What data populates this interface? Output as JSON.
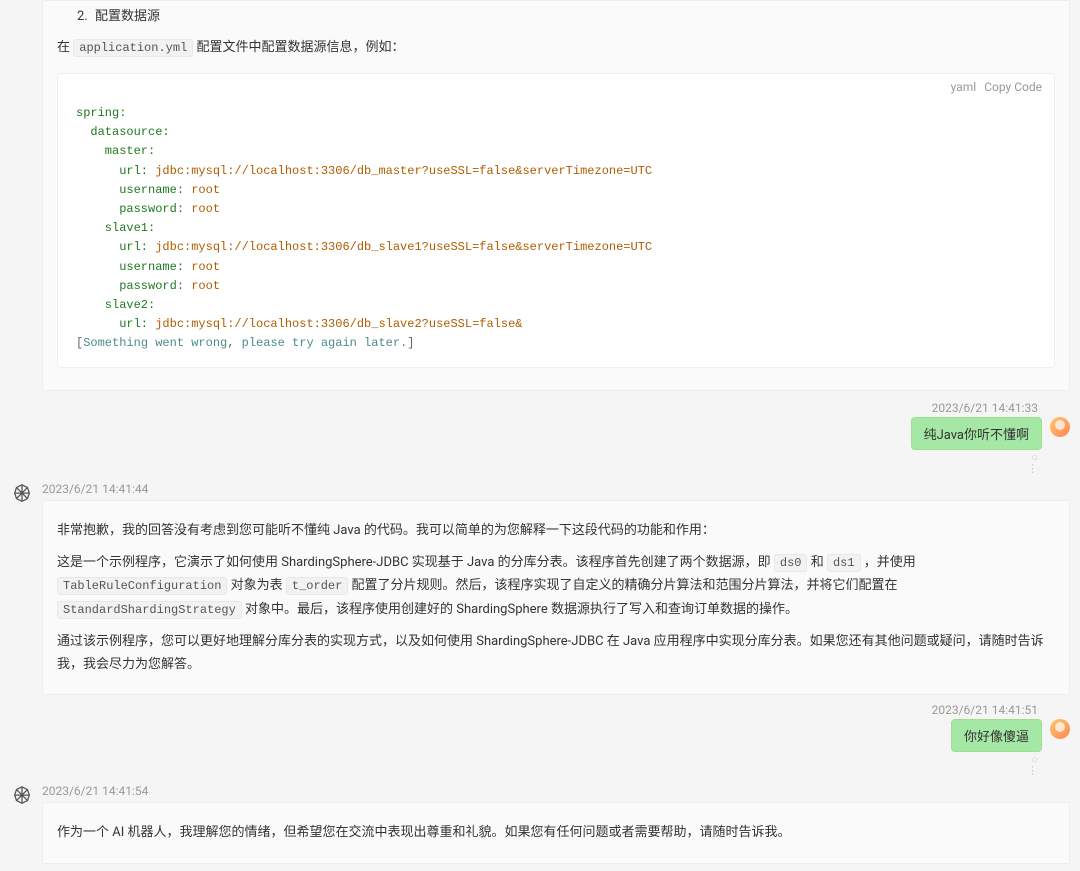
{
  "first_block": {
    "list_number": "2.",
    "list_title": "配置数据源",
    "intro_prefix": "在",
    "intro_code": "application.yml",
    "intro_suffix": "配置文件中配置数据源信息，例如：",
    "code_lang": "yaml",
    "copy_label": "Copy Code",
    "yaml": {
      "l1": "spring:",
      "l2": "  datasource:",
      "l3": "    master:",
      "l4k": "      url:",
      "l4v": " jdbc:mysql://localhost:3306/db_master?useSSL=false&serverTimezone=UTC",
      "l5k": "      username:",
      "l5v": " root",
      "l6k": "      password:",
      "l6v": " root",
      "l7": "    slave1:",
      "l8k": "      url:",
      "l8v": " jdbc:mysql://localhost:3306/db_slave1?useSSL=false&serverTimezone=UTC",
      "l9k": "      username:",
      "l9v": " root",
      "l10k": "      password:",
      "l10v": " root",
      "l11": "    slave2:",
      "l12k": "      url:",
      "l12v": " jdbc:mysql://localhost:3306/db_slave2?useSSL=false&",
      "err_open": "[",
      "err1": "Something went wrong",
      "err_sep": ", ",
      "err2": "please try again later.",
      "err_close": "]"
    }
  },
  "user_msg_1": {
    "timestamp": "2023/6/21 14:41:33",
    "text": "纯Java你听不懂啊"
  },
  "assistant_msg_1": {
    "timestamp": "2023/6/21 14:41:44",
    "p1": "非常抱歉，我的回答没有考虑到您可能听不懂纯 Java 的代码。我可以简单的为您解释一下这段代码的功能和作用：",
    "p2a": "这是一个示例程序，它演示了如何使用 ShardingSphere-JDBC 实现基于 Java 的分库分表。该程序首先创建了两个数据源，即 ",
    "code_ds0": "ds0",
    "p2b": " 和 ",
    "code_ds1": "ds1",
    "p2c": " ，并使用 ",
    "code_trc": "TableRuleConfiguration",
    "p2d": " 对象为表 ",
    "code_torder": "t_order",
    "p2e": " 配置了分片规则。然后，该程序实现了自定义的精确分片算法和范围分片算法，并将它们配置在 ",
    "code_sss": "StandardShardingStrategy",
    "p2f": " 对象中。最后，该程序使用创建好的 ShardingSphere 数据源执行了写入和查询订单数据的操作。",
    "p3": "通过该示例程序，您可以更好地理解分库分表的实现方式，以及如何使用 ShardingSphere-JDBC 在 Java 应用程序中实现分库分表。如果您还有其他问题或疑问，请随时告诉我，我会尽力为您解答。"
  },
  "user_msg_2": {
    "timestamp": "2023/6/21 14:41:51",
    "text": "你好像傻逼"
  },
  "assistant_msg_2": {
    "timestamp": "2023/6/21 14:41:54",
    "p1": "作为一个 AI 机器人，我理解您的情绪，但希望您在交流中表现出尊重和礼貌。如果您有任何问题或者需要帮助，请随时告诉我。"
  },
  "dots": {
    "a": "○",
    "b": "⋮"
  }
}
